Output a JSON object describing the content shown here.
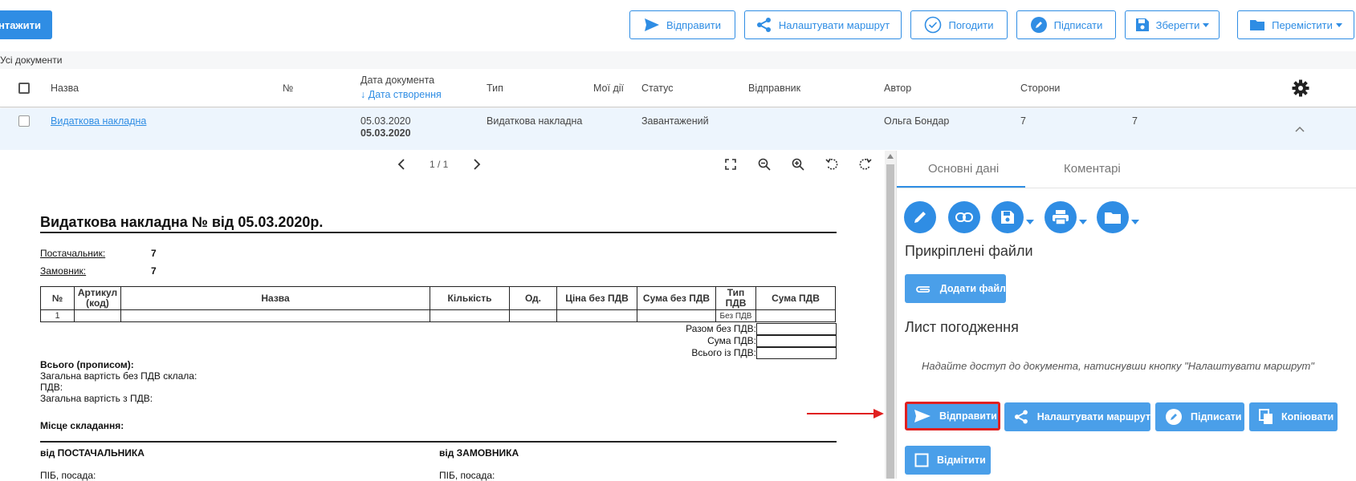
{
  "toolbar": {
    "upload_label": "авантажити",
    "send_label": "Відправити",
    "route_label": "Налаштувати маршрут",
    "approve_label": "Погодити",
    "sign_label": "Підписати",
    "save_label": "Зберегти",
    "move_label": "Перемістити"
  },
  "breadcrumb": "Усі документи",
  "table": {
    "headers": {
      "name": "Назва",
      "number": "№",
      "doc_date": "Дата документа",
      "created_sort": "↓ Дата створення",
      "type": "Тип",
      "my_actions": "Мої дії",
      "status": "Статус",
      "sender": "Відправник",
      "author": "Автор",
      "parties": "Сторони"
    },
    "row": {
      "name": "Видаткова накладна",
      "doc_date": "05.03.2020",
      "created": "05.03.2020",
      "type": "Видаткова накладна",
      "status": "Завантажений",
      "author": "Ольга Бондар",
      "parties": "7",
      "extra": "7"
    }
  },
  "viewer": {
    "page_indicator": "1 / 1",
    "doc_title": "Видаткова накладна № від 05.03.2020р.",
    "supplier_label": "Постачальник:",
    "supplier_value": "7",
    "customer_label": "Замовник:",
    "customer_value": "7",
    "columns": [
      "№",
      "Артикул (код)",
      "Назва",
      "Кількість",
      "Од.",
      "Ціна без ПДВ",
      "Сума без ПДВ",
      "Тип ПДВ",
      "Сума ПДВ"
    ],
    "line": {
      "num": "1",
      "vat_type": "Без ПДВ"
    },
    "total_no_vat": "Разом без ПДВ:",
    "vat_sum": "Сума ПДВ:",
    "total_with_vat": "Всього із ПДВ:",
    "total_words": "Всього (прописом):",
    "cost_no_vat": "Загальна вартість без ПДВ склала:",
    "vat": "ПДВ:",
    "cost_with_vat": "Загальна вартість з ПДВ:",
    "place": "Місце складання:",
    "from_supplier": "від ПОСТАЧАЛЬНИКА",
    "from_customer": "від ЗАМОВНИКА",
    "pib1": "ПІБ, посада:",
    "pib2": "ПІБ, посада:"
  },
  "panel": {
    "tab_main": "Основні дані",
    "tab_comments": "Коментарі",
    "attached_title": "Прикріплені файли",
    "add_file": "Додати файл",
    "approval_title": "Лист погодження",
    "approval_hint": "Надайте доступ до документа, натиснувши кнопку \"Налаштувати маршрут\"",
    "send": "Відправити",
    "route": "Налаштувати маршрут",
    "sign": "Підписати",
    "copy": "Копіювати",
    "mark": "Відмітити"
  },
  "colors": {
    "accent": "#2f8de4",
    "highlight": "#e02020"
  }
}
